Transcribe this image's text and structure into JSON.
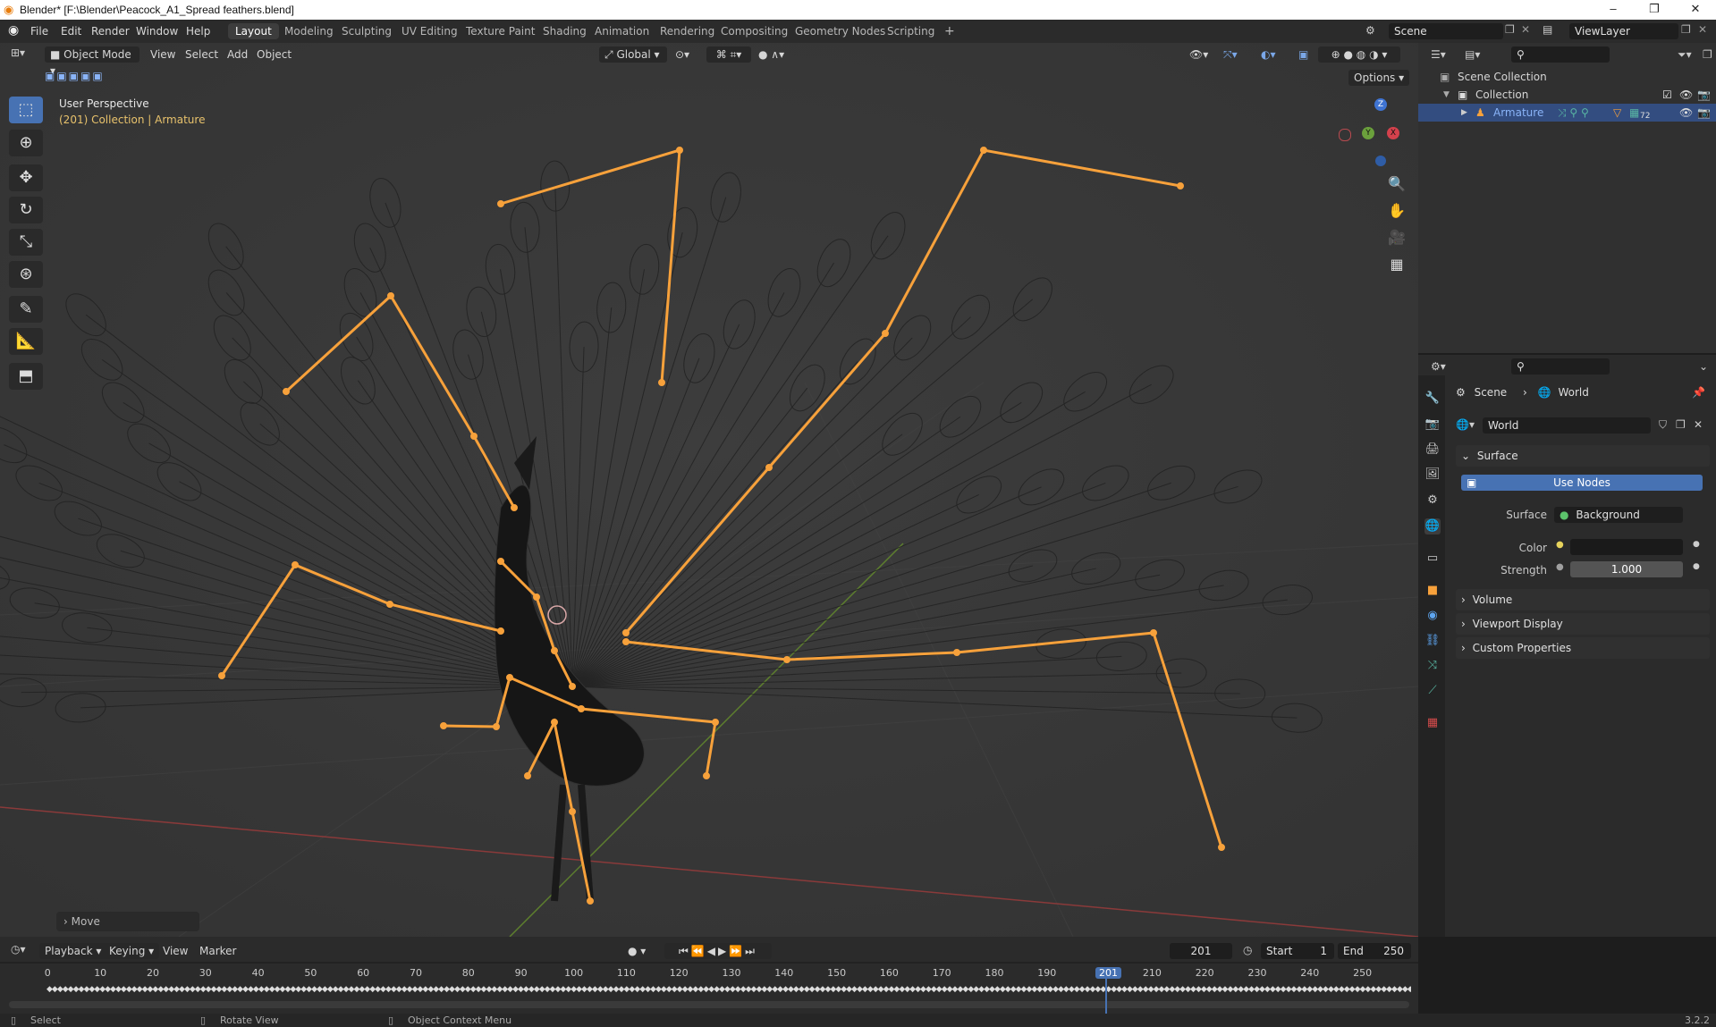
{
  "title_bar": {
    "title": "Blender* [F:\\Blender\\Peacock_A1_Spread feathers.blend]"
  },
  "menu": [
    "File",
    "Edit",
    "Render",
    "Window",
    "Help"
  ],
  "workspaces": [
    "Layout",
    "Modeling",
    "Sculpting",
    "UV Editing",
    "Texture Paint",
    "Shading",
    "Animation",
    "Rendering",
    "Compositing",
    "Geometry Nodes",
    "Scripting"
  ],
  "active_workspace": "Layout",
  "scene_field": "Scene",
  "viewlayer_field": "ViewLayer",
  "viewport": {
    "mode": "Object Mode",
    "menus": [
      "View",
      "Select",
      "Add",
      "Object"
    ],
    "orientation": "Global",
    "options_label": "Options",
    "perspective": "User Perspective",
    "context": "(201) Collection | Armature",
    "operator_panel": "Move",
    "gizmo": {
      "z": "Z",
      "y": "Y",
      "x": "X"
    },
    "accent": "#f7a13b"
  },
  "outliner": {
    "scene_collection": "Scene Collection",
    "collection": "Collection",
    "armature": "Armature",
    "modifier_count": "72"
  },
  "properties": {
    "breadcrumb_scene": "Scene",
    "breadcrumb_world": "World",
    "world_name": "World",
    "surface_panel": "Surface",
    "use_nodes": "Use Nodes",
    "surface_label": "Surface",
    "surface_value": "Background",
    "color_label": "Color",
    "strength_label": "Strength",
    "strength_value": "1.000",
    "volume_panel": "Volume",
    "viewport_display_panel": "Viewport Display",
    "custom_properties_panel": "Custom Properties"
  },
  "timeline": {
    "menus": [
      "Playback",
      "Keying",
      "View",
      "Marker"
    ],
    "current_frame": "201",
    "start_label": "Start",
    "start_value": "1",
    "end_label": "End",
    "end_value": "250",
    "ticks": [
      "0",
      "10",
      "20",
      "30",
      "40",
      "50",
      "60",
      "70",
      "80",
      "90",
      "100",
      "110",
      "120",
      "130",
      "140",
      "150",
      "160",
      "170",
      "180",
      "190",
      "201",
      "210",
      "220",
      "230",
      "240",
      "250"
    ]
  },
  "statusbar": {
    "select": "Select",
    "rotate": "Rotate View",
    "context_menu": "Object Context Menu",
    "version": "3.2.2"
  }
}
